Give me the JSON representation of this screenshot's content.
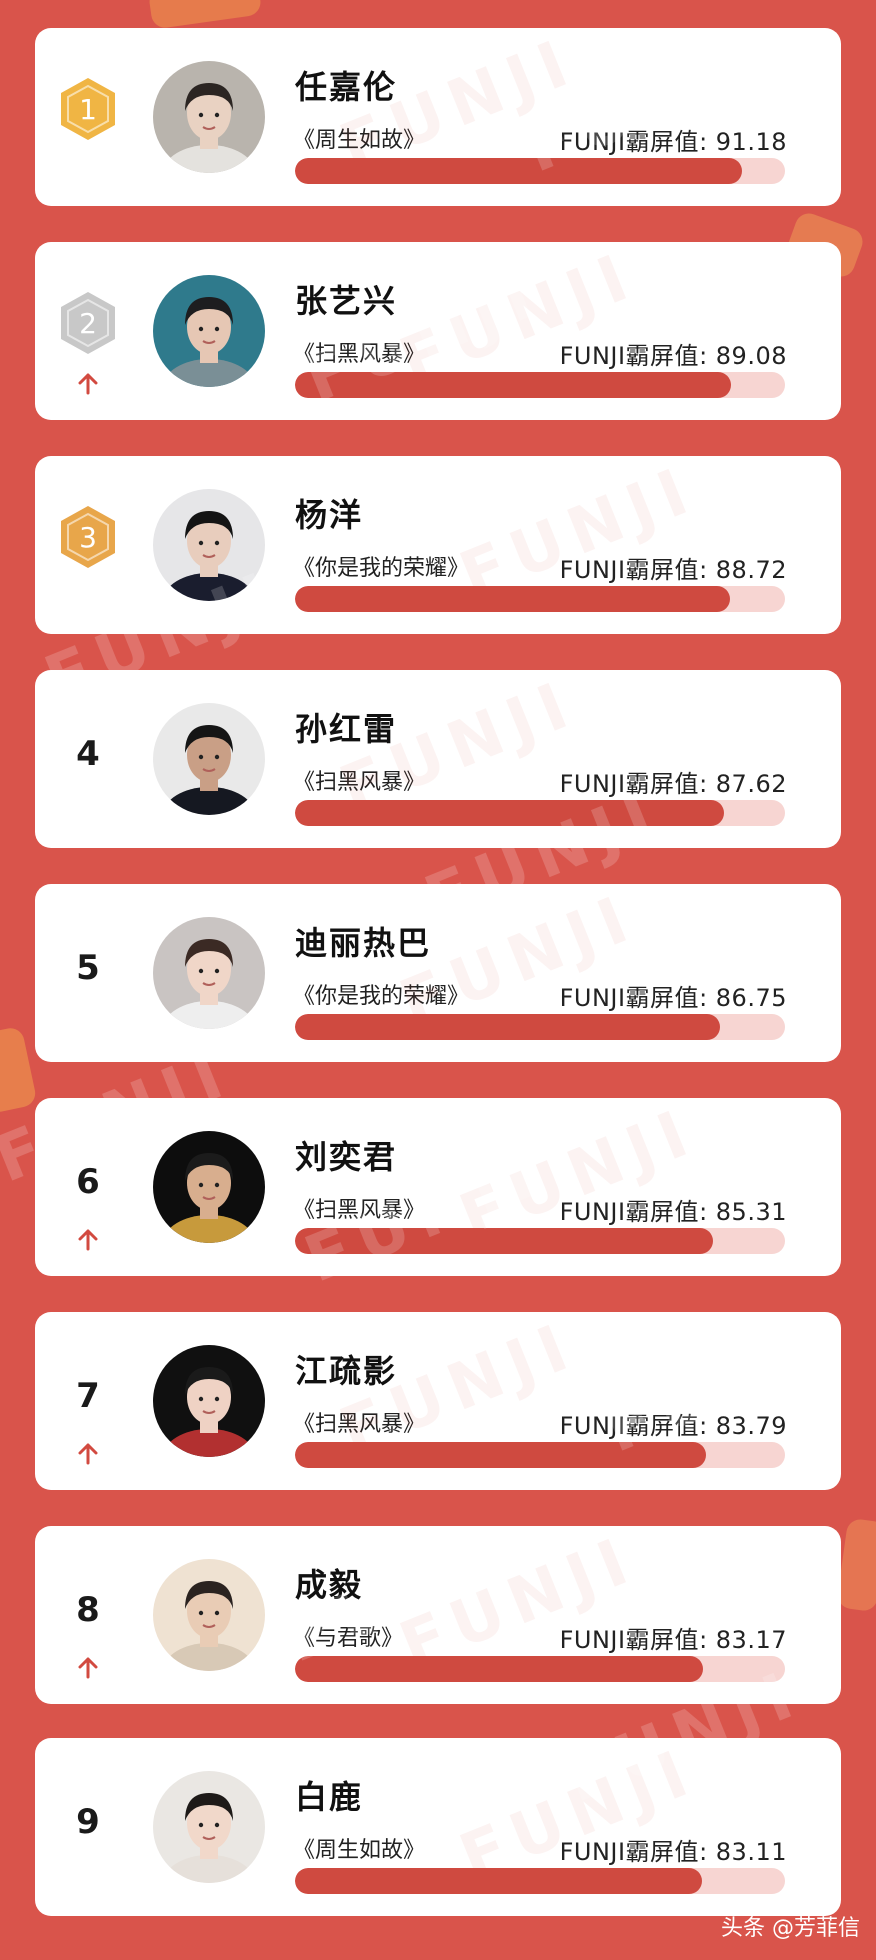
{
  "watermark": "FUNJI",
  "score_label": "FUNJI霸屏值",
  "footer": "头条 @芳菲信",
  "colors": {
    "background": "#d9544b",
    "bar_fill": "#cf4a40",
    "bar_track": "#f7d5d2",
    "gold": "#f0b544",
    "silver": "#c8c8c8",
    "bronze": "#e8a64a",
    "up_arrow": "#d24a40"
  },
  "score_max": 100,
  "rankings": [
    {
      "rank": "1",
      "medal": "gold",
      "rank_up": false,
      "name": "任嘉伦",
      "drama": "《周生如故》",
      "score": "91.18",
      "avatar": {
        "bg": "#b9b4ad",
        "skin": "#e9d2c2",
        "hair": "#2b2522",
        "shirt": "#e4e2de"
      }
    },
    {
      "rank": "2",
      "medal": "silver",
      "rank_up": true,
      "name": "张艺兴",
      "drama": "《扫黑风暴》",
      "score": "89.08",
      "avatar": {
        "bg": "#2f7a8c",
        "skin": "#e6c7b4",
        "hair": "#1d1d1f",
        "shirt": "#7a8f96"
      }
    },
    {
      "rank": "3",
      "medal": "bronze",
      "rank_up": false,
      "name": "杨洋",
      "drama": "《你是我的荣耀》",
      "score": "88.72",
      "avatar": {
        "bg": "#e6e6e8",
        "skin": "#e8cdbd",
        "hair": "#141414",
        "shirt": "#1a1d2e"
      }
    },
    {
      "rank": "4",
      "medal": "",
      "rank_up": false,
      "name": "孙红雷",
      "drama": "《扫黑风暴》",
      "score": "87.62",
      "avatar": {
        "bg": "#e9e9e9",
        "skin": "#c99f86",
        "hair": "#151515",
        "shirt": "#151821"
      }
    },
    {
      "rank": "5",
      "medal": "",
      "rank_up": false,
      "name": "迪丽热巴",
      "drama": "《你是我的荣耀》",
      "score": "86.75",
      "avatar": {
        "bg": "#c9c4c2",
        "skin": "#f0d6c8",
        "hair": "#3b2a24",
        "shirt": "#eeeeee"
      }
    },
    {
      "rank": "6",
      "medal": "",
      "rank_up": true,
      "name": "刘奕君",
      "drama": "《扫黑风暴》",
      "score": "85.31",
      "avatar": {
        "bg": "#0d0d0d",
        "skin": "#d8ae8e",
        "hair": "#1b1b1b",
        "shirt": "#c79a3c"
      }
    },
    {
      "rank": "7",
      "medal": "",
      "rank_up": true,
      "name": "江疏影",
      "drama": "《扫黑风暴》",
      "score": "83.79",
      "avatar": {
        "bg": "#101010",
        "skin": "#efd2c4",
        "hair": "#1a1a1a",
        "shirt": "#b23030"
      }
    },
    {
      "rank": "8",
      "medal": "",
      "rank_up": true,
      "name": "成毅",
      "drama": "《与君歌》",
      "score": "83.17",
      "avatar": {
        "bg": "#efe2d2",
        "skin": "#e9ccb5",
        "hair": "#2b2320",
        "shirt": "#d8c9b6"
      }
    },
    {
      "rank": "9",
      "medal": "",
      "rank_up": false,
      "name": "白鹿",
      "drama": "《周生如故》",
      "score": "83.11",
      "avatar": {
        "bg": "#eae7e3",
        "skin": "#f1d8ca",
        "hair": "#1e1a18",
        "shirt": "#e6e0da"
      }
    }
  ]
}
